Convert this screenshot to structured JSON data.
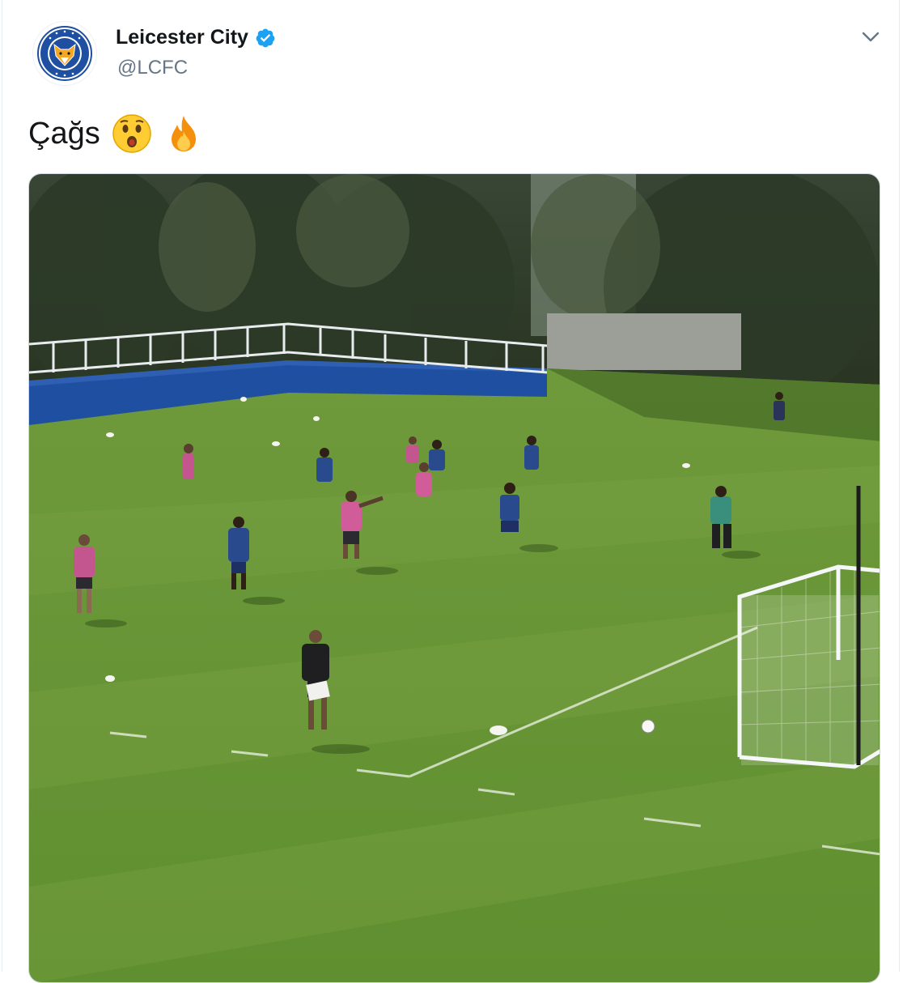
{
  "tweet": {
    "display_name": "Leicester City",
    "handle": "@LCFC",
    "text": "Çağs",
    "emojis": [
      "astonished-face-emoji",
      "fire-emoji"
    ],
    "verified": true
  },
  "icons": {
    "avatar": "leicester-city-crest",
    "verified": "verified-badge-icon",
    "menu": "chevron-down-icon"
  },
  "colors": {
    "verified_blue": "#1da1f2",
    "handle_gray": "#657786",
    "pitch_green": "#6f9a3c",
    "club_blue": "#1f4fa0"
  },
  "media": {
    "type": "video-still",
    "description_icon": "training-pitch-image"
  }
}
